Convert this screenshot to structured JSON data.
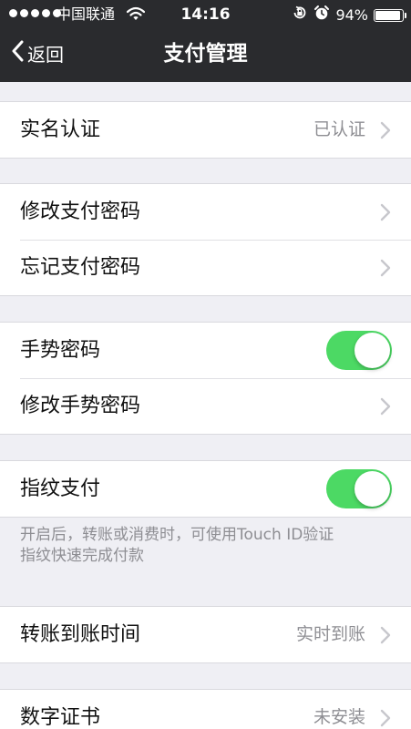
{
  "status_bar": {
    "carrier": "中国联通",
    "time": "14:16",
    "battery": "94%",
    "battery_level": 0.94,
    "icons": [
      "signal-dots-icon",
      "wifi-icon",
      "rotation-lock-icon",
      "alarm-icon",
      "battery-icon"
    ]
  },
  "nav": {
    "back_label": "返回",
    "title": "支付管理"
  },
  "items": {
    "real_name": {
      "label": "实名认证",
      "value": "已认证"
    },
    "change_pay_password": {
      "label": "修改支付密码"
    },
    "forgot_pay_password": {
      "label": "忘记支付密码"
    },
    "gesture_password": {
      "label": "手势密码",
      "enabled": true
    },
    "change_gesture_password": {
      "label": "修改手势密码"
    },
    "fingerprint_pay": {
      "label": "指纹支付",
      "enabled": true,
      "footnote_line1": "开启后，转账或消费时，可使用Touch ID验证",
      "footnote_line2": "指纹快速完成付款"
    },
    "transfer_time": {
      "label": "转账到账时间",
      "value": "实时到账"
    },
    "digital_cert": {
      "label": "数字证书",
      "value": "未安装"
    }
  },
  "colors": {
    "nav_background": "#2a2b2e",
    "page_background": "#efeff4",
    "toggle_on": "#4cd964",
    "secondary_text": "#8e8e93"
  }
}
